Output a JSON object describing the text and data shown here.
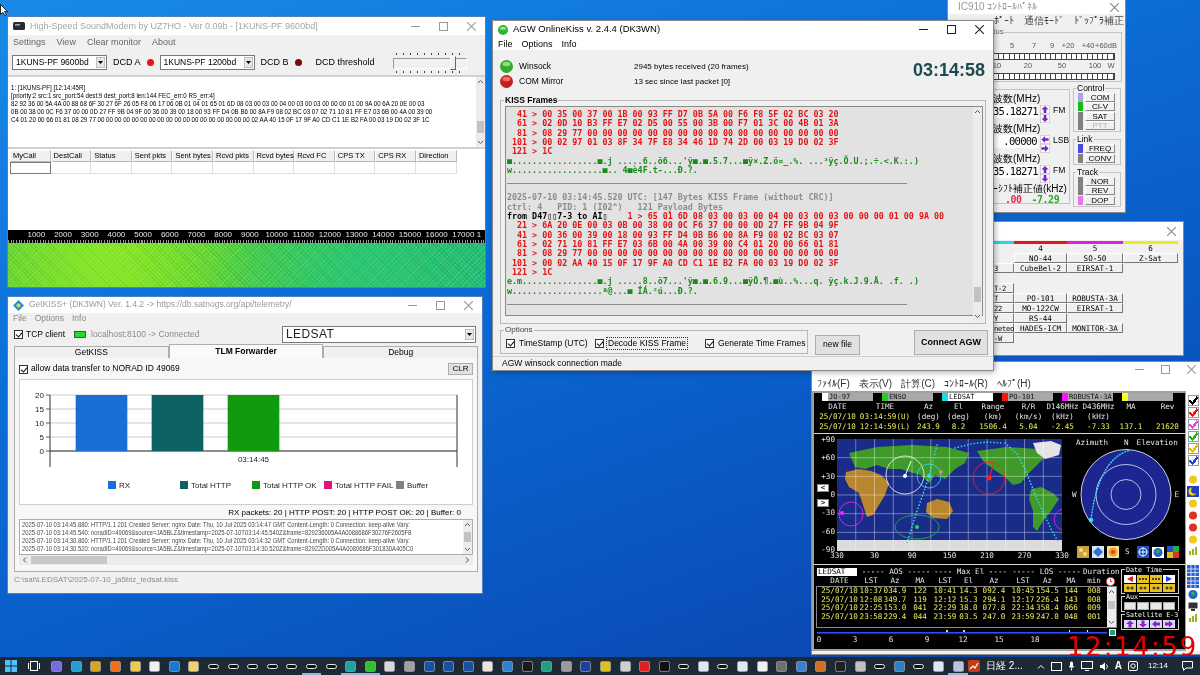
{
  "soundmodem": {
    "title": "High-Speed SoundModem by UZ7HO - Ver 0.09b - [1KUNS-PF 9600bd]",
    "menu": [
      "Settings",
      "View",
      "Clear monitor",
      "About"
    ],
    "modem_a": {
      "value": "1KUNS-PF 9600bd"
    },
    "dcd_a": {
      "label": "DCD A",
      "on": true
    },
    "modem_b": {
      "value": "1KUNS-PF 1200bd"
    },
    "dcd_b": {
      "label": "DCD B",
      "on": false
    },
    "threshold": {
      "label": "DCD threshold",
      "level": 0.82
    },
    "monitor": [
      "1: [1KUNS-PF] [12:14:45R]",
      "[priority:2 src:1 src_port:54 dest:9 dest_port:8 len:144 FEC_err:0 RS_err:4]",
      "82 92 36 00 5A 4A 00 88 68 6F 30 27 6F 26 05 F8 06 17 06 0B 01 04 01 65 01 6D 08 03 00 03 00 04 00 03 00 03 00 00 00 01 00 9A 00 6A 20 0E 00 03",
      "0B 00 38 00 0C F6 37 00 00 0D 27 FF 9B 04 9F 00 36 00 39 00 18 00 93 FF D4 0B B6 00 8A F9 08 02 BC 03 07 02 71 10 81 FF E7 03 6B 00 4A 00 39 00",
      "C4 01 20 00 66 01 81 08 29 77 00 00 00 00 00 00 00 00 00 00 00 00 00 00 00 00 00 00 02 AA 40 15 0F 17 9F A0 CD C1 1E B2 FA 00 03 19 D0 02 3F 1C"
    ],
    "table": {
      "columns": [
        "MyCall",
        "DestCall",
        "Status",
        "Sent pkts",
        "Sent bytes",
        "Rcvd pkts",
        "Rcvd bytes",
        "Rcvd FC",
        "CPS TX",
        "CPS RX",
        "Direction"
      ]
    },
    "waterfall": {
      "scale": [
        "1000",
        "2000",
        "3000",
        "4000",
        "5000",
        "6000",
        "7000",
        "8000",
        "9000",
        "10000",
        "11000",
        "12000",
        "13000",
        "14000",
        "15000",
        "16000",
        "17000",
        "1"
      ]
    }
  },
  "agw": {
    "title": "AGW OnlineKiss v. 2.4.4  (DK3WN)",
    "menu": [
      "File",
      "Options",
      "Info"
    ],
    "lamps": [
      {
        "label": "Winsock",
        "on": true
      },
      {
        "label": "COM Mirror",
        "on": false
      }
    ],
    "stats": [
      "2945 bytes received (20 frames)",
      "13 sec since last packet [0]"
    ],
    "clock": "03:14:58",
    "kiss_frames": {
      "label": "KISS Frames",
      "lines": [
        {
          "kind": "hex",
          "text": "  41 > 00 35 00 37 00 1B 00 93 FF D7 0B 5A 00 F6 F8 5F 02 BC 03 20"
        },
        {
          "kind": "hex",
          "text": "  61 > 02 0D 10 B3 FF E7 02 D5 00 55 00 3B 00 F7 01 3C 00 4B 01 3A"
        },
        {
          "kind": "hex",
          "text": "  81 > 08 29 77 00 00 00 00 00 00 00 00 00 00 00 00 00 00 00 00 00"
        },
        {
          "kind": "hex",
          "text": " 101 > 00 02 97 01 03 8F 34 7F E8 34 46 1D 74 2D 00 03 19 D0 02 3F"
        },
        {
          "kind": "hex",
          "text": " 121 > 1C"
        },
        {
          "kind": "ascii",
          "text": "■.................■.j .....6..ö6...'ÿ■.■.5.7...■ÿ×.Z.ö¤_.%. ...³ÿç.Õ.U.;.÷.<.K.:.)"
        },
        {
          "kind": "ascii",
          "text": "w..................■.. 4■è4F.t-...Ð.?."
        },
        {
          "kind": "rule"
        },
        {
          "kind": "meta",
          "text": "2025-07-10 03:14:45.520 UTC: [147 Bytes KISS Frame (without CRC)]"
        },
        {
          "kind": "meta",
          "text": "ctrl: 4   PID: 1 (I02^)   121 Payload Bytes"
        },
        {
          "kind": "from",
          "prefix": "from D47▯▯7-3 to AI▯",
          "text": "    1 > 65 01 6D 08 03 00 03 00 04 00 03 00 03 00 00 00 01 00 9A 00"
        },
        {
          "kind": "hex",
          "text": "  21 > 6A 20 0E 00 03 0B 00 38 00 0C F6 37 00 00 0D 27 FF 9B 04 9F"
        },
        {
          "kind": "hex",
          "text": "  41 > 00 36 00 39 00 18 00 93 FF D4 0B B6 00 8A F9 08 02 BC 03 07"
        },
        {
          "kind": "hex",
          "text": "  61 > 02 71 10 81 FF E7 03 6B 00 4A 00 39 00 C4 01 20 00 66 01 81"
        },
        {
          "kind": "hex",
          "text": "  81 > 08 29 77 00 00 00 00 00 00 00 00 00 00 00 00 00 00 00 00 00"
        },
        {
          "kind": "hex",
          "text": " 101 > 00 02 AA 40 15 0F 17 9F A0 CD C1 1E B2 FA 00 03 19 D0 02 3F"
        },
        {
          "kind": "hex",
          "text": " 121 > 1C"
        },
        {
          "kind": "ascii",
          "text": "e.m...............■.j .....8..ö7...'ÿ■.■.6.9...■ÿÖ.¶.■ù..%...q. ÿç.k.J.9.Ä. .f. .)"
        },
        {
          "kind": "ascii",
          "text": "w..................ª@...■ ÍÁ.²ú...Ð.?."
        },
        {
          "kind": "rule"
        }
      ]
    },
    "options": {
      "label": "Options",
      "checks": [
        {
          "label": "TimeStamp (UTC)",
          "checked": true,
          "focused": false
        },
        {
          "label": "Decode KISS Frame",
          "checked": true,
          "focused": true
        },
        {
          "label": "Generate Time Frames",
          "checked": true,
          "focused": false
        }
      ]
    },
    "buttons": [
      "new file",
      "Connect AGW"
    ],
    "status": "AGW winsock connection made"
  },
  "getkiss": {
    "title": "GetKISS+ (DK3WN) Ver. 1.4.2 -> https://db.satnogs.org/api/telemetry/",
    "menu": [
      "File",
      "Options",
      "Info"
    ],
    "tcp_client": {
      "label": "TCP client",
      "checked": true
    },
    "connection": {
      "text": "localhost:8100 -> Connected",
      "on": true
    },
    "satellite": {
      "value": "LEDSAT"
    },
    "tabs": [
      {
        "label": "GetKISS",
        "selected": false
      },
      {
        "label": "TLM Forwarder",
        "selected": true
      },
      {
        "label": "Debug",
        "selected": false
      }
    ],
    "allow": {
      "label": "allow data transfer to NORAD ID 49069",
      "checked": true
    },
    "clear_button": "CLR",
    "chart_data": {
      "type": "bar",
      "categories": [
        "03:14:45"
      ],
      "series": [
        {
          "name": "RX",
          "color": "#1a6fd4",
          "values": [
            20
          ]
        },
        {
          "name": "Total HTTP",
          "color": "#0d6263",
          "values": [
            20
          ]
        },
        {
          "name": "Total HTTP OK",
          "color": "#109a10",
          "values": [
            20
          ]
        },
        {
          "name": "Total HTTP FAIL",
          "color": "#e0157c",
          "values": [
            0
          ]
        },
        {
          "name": "Buffer",
          "color": "#808080",
          "values": [
            0
          ]
        }
      ],
      "ylim": [
        0,
        20
      ],
      "yticks": [
        {
          "value": 0,
          "label": "0"
        },
        {
          "value": 5,
          "label": "5"
        },
        {
          "value": 10,
          "label": "10"
        },
        {
          "value": 15,
          "label": "15"
        },
        {
          "value": 20,
          "label": "20"
        }
      ],
      "grid": true,
      "legend": true
    },
    "summary": "RX packets: 20 | HTTP POST: 20 | HTTP POST OK: 20 | Buffer: 0",
    "log": [
      "2025-07-10 03:14:45.880: HTTP/1.1 201 Created Server: nginx Date: Thu, 10 Jul 2025 03:14:47 GMT Content-Length: 0 Connection: keep-alive Vary:",
      "2025-07-10 03:14:45.540: noradID=49069&source=JA5BLZ&timestamp=2025-07-10T03:14:45.540Z&frame=829236005A4A0088686F30276F2605F8",
      "2025-07-10 03:14:30.860: HTTP/1.1 201 Created Server: nginx Date: Thu, 10 Jul 2025 03:14:32 GMT Content-Length: 0 Connection: keep-alive Vary:",
      "2025-07-10 03:14:30.520: noradID=49069&source=JA5BLZ&timestamp=2025-07-10T03:14:30.520Z&frame=82922D005A4A0080686F301830A405C0"
    ],
    "file_path": "C:\\sat\\LEDSAT\\2025-07-10_ja5blz_ledsat.kiss"
  },
  "ic910": {
    "title": "IC910 ｺﾝﾄﾛｰﾙﾊﾟﾈﾙ",
    "menu": [
      "ﾎﾟｰﾄ",
      "通信ﾓｰﾄﾞ",
      "ﾄﾞｯﾌﾟﾗ補正"
    ],
    "status": {
      "label": "tus",
      "s_scale": [
        "5",
        "7",
        "9",
        "+20",
        "+40",
        "+60dB"
      ],
      "po_scale": [
        "10",
        "20",
        "50",
        "100",
        "W"
      ]
    },
    "frequencies": [
      {
        "label": "波数(MHz)",
        "value": "35.18271",
        "kind": "vertical_arrows",
        "mode": "FM"
      },
      {
        "label": "波数(MHz)",
        "value": ".00000",
        "kind": "horizontal_arrows",
        "mode": "LSB"
      },
      {
        "label": "波数(MHz)",
        "value": "35.18271",
        "kind": "vertical_arrows",
        "mode": "FM"
      }
    ],
    "doppler": {
      "label": "ｰｼﾌﾄ補正値(kHz)",
      "values": [
        {
          "text": ".00",
          "color": "#e0305a"
        },
        {
          "text": "-7.29",
          "color": "#2aa82a"
        }
      ]
    },
    "control": {
      "label": "Control",
      "items": [
        {
          "label": "COM",
          "color": "#a8a8e8",
          "disabled": false
        },
        {
          "label": "CI-V",
          "color": "#10c010",
          "disabled": false
        },
        {
          "label": "SAT",
          "color": "#808080",
          "disabled": false
        },
        {
          "label": "PTT",
          "color": "#808080",
          "disabled": true
        }
      ]
    },
    "link": {
      "label": "Link",
      "items": [
        {
          "label": "FREQ",
          "color": "#4a4ae0"
        },
        {
          "label": "CONV",
          "color": "#808080"
        }
      ]
    },
    "track": {
      "label": "Track",
      "items": [
        {
          "label": "NOR",
          "color": "#808080"
        },
        {
          "label": "REV",
          "color": "#808080"
        },
        {
          "label": "DOP",
          "color": "#e878e8"
        }
      ]
    }
  },
  "sat_list": {
    "columns": [
      {
        "color": "#20d8e8"
      },
      {
        "label": "4",
        "color": "#e01818"
      },
      {
        "label": "5",
        "color": "#e020e0"
      },
      {
        "label": "6",
        "color": "#f0e820"
      }
    ],
    "groups": [
      {
        "rows": [
          [
            null,
            "NO-44",
            "SO-50",
            "Z-Sat"
          ],
          [
            "3",
            "CubeBel-2",
            "EIRSAT-1"
          ]
        ]
      },
      {
        "rows": [
          [
            "T-2"
          ],
          [
            "T",
            "PO-101",
            "ROBUSTA-3A"
          ],
          [
            "22",
            "MO-122CW",
            "EIRSAT-1"
          ],
          [
            "Y",
            "RS-44"
          ],
          [
            "neteo",
            "HADES-ICM",
            "MONITOR-3A"
          ],
          [
            "-W"
          ]
        ]
      }
    ]
  },
  "tracker": {
    "menu": [
      "ﾌｧｲﾙ(F)",
      "表示(V)",
      "計算(C)",
      "ｺﾝﾄﾛｰﾙ(R)",
      "ﾍﾙﾌﾟ(H)"
    ],
    "satellites": [
      {
        "label": "JO-97",
        "color": "#ffffff",
        "selected": false
      },
      {
        "label": "ENSO",
        "color": "#20d020",
        "selected": false
      },
      {
        "label": "LEDSAT",
        "color": "#10e0e8",
        "selected": true
      },
      {
        "label": "PO-101",
        "color": "#ff1010",
        "selected": false
      },
      {
        "label": "ROBUSTA-3A",
        "color": "#ff10ff",
        "selected": false
      },
      {
        "color": "#ffff10",
        "selected": false
      }
    ],
    "position": {
      "columns": [
        {
          "label": "DATE"
        },
        {
          "label": "TIME"
        },
        {
          "label": "Az",
          "unit": "(deg)"
        },
        {
          "label": "El",
          "unit": "(deg)"
        },
        {
          "label": "Range",
          "unit": "(km)"
        },
        {
          "label": "R/R",
          "unit": "(km/s)"
        },
        {
          "label": "D146MHz",
          "unit": "(kHz)"
        },
        {
          "label": "D436MHz",
          "unit": "(kHz)"
        },
        {
          "label": "MA"
        },
        {
          "label": "Rev"
        }
      ],
      "rows": [
        [
          "25/07/10",
          "03:14:59(U)"
        ],
        [
          "25/07/10",
          "12:14:59(L)",
          "243.9",
          "8.2",
          "1506.4",
          "5.04",
          "-2.45",
          "-7.33",
          "137.1",
          "21620"
        ]
      ]
    },
    "map": {
      "lat_labels": [
        "+90",
        "+60",
        "+30",
        "0",
        "-30",
        "-60",
        "-90"
      ],
      "lon_labels": [
        "330",
        "30",
        "90",
        "150",
        "210",
        "270",
        "330"
      ],
      "nav": [
        "<",
        ">"
      ]
    },
    "polar": {
      "azimuth": "Azimuth",
      "north": "N",
      "elevation": "Elevation",
      "west": "W",
      "east": "E",
      "south": "S"
    },
    "passes": {
      "satellite": "LEDSAT",
      "groups": [
        "----- AOS -----",
        "---- Max El ----",
        "----- LOS -----",
        "Duration"
      ],
      "columns": [
        "DATE",
        "LST",
        "Az",
        "MA",
        "LST",
        "El",
        "Az",
        "LST",
        "Az",
        "MA",
        "min"
      ],
      "rows": [
        [
          "25/07/10",
          "10:37",
          "034.9",
          "122",
          "10:41",
          "14.3",
          "092.4",
          "10:45",
          "154.5",
          "144",
          "008"
        ],
        [
          "25/07/10",
          "12:08",
          "349.7",
          "119",
          "12:12",
          "15.3",
          "294.1",
          "12:17",
          "226.4",
          "143",
          "008"
        ],
        [
          "25/07/10",
          "22:25",
          "153.0",
          "041",
          "22:29",
          "38.0",
          "077.8",
          "22:34",
          "358.4",
          "066",
          "009"
        ],
        [
          "25/07/10",
          "23:58",
          "229.4",
          "044",
          "23:59",
          "03.5",
          "247.0",
          "23:59",
          "247.0",
          "048",
          "001"
        ]
      ]
    },
    "timeline": [
      "0",
      "3",
      "6",
      "9",
      "12",
      "15",
      "18"
    ],
    "panels": [
      {
        "label": "Date Time"
      },
      {
        "label": "Aux"
      },
      {
        "label": "Satellite E-3"
      }
    ],
    "side_checks": [
      {
        "checked": true,
        "color": "#000000"
      },
      {
        "checked": true,
        "color": "#e01818"
      },
      {
        "checked": true,
        "color": "#e050e0"
      },
      {
        "checked": true,
        "color": "#20b020"
      },
      {
        "checked": true,
        "color": "#e0c000"
      },
      {
        "checked": true,
        "color": "#2040e0"
      }
    ]
  },
  "overlay_clock": {
    "time": "12:14:59"
  },
  "taskbar": {
    "apps": [
      {
        "kind": "tile",
        "color": "#7a6ae0",
        "running": false
      },
      {
        "kind": "tile",
        "color": "#1fa0d0",
        "running": false
      },
      {
        "kind": "tile",
        "color": "#d9a620",
        "running": false
      },
      {
        "kind": "tile",
        "color": "#f07020",
        "running": false
      },
      {
        "kind": "tile",
        "color": "#f2c94c",
        "running": false
      },
      {
        "kind": "tile",
        "color": "#f0f0f0",
        "running": false
      },
      {
        "kind": "tile",
        "color": "#1a78d0",
        "running": false
      },
      {
        "kind": "tile",
        "color": "#f0d070",
        "running": false
      },
      {
        "kind": "pill",
        "running": false
      },
      {
        "kind": "pill",
        "running": false
      },
      {
        "kind": "pill",
        "running": false
      },
      {
        "kind": "pill",
        "running": false
      },
      {
        "kind": "pill",
        "running": false
      },
      {
        "kind": "pill",
        "running": true
      },
      {
        "kind": "pill",
        "running": false
      },
      {
        "kind": "tile",
        "color": "#20a0a0",
        "running": true
      },
      {
        "kind": "tile",
        "color": "#30c030",
        "running": true
      },
      {
        "kind": "tile",
        "color": "#d8d8d8",
        "running": false
      },
      {
        "kind": "tile",
        "color": "#a0a0a0",
        "running": false
      },
      {
        "kind": "tile",
        "color": "#1a50a0",
        "running": false
      },
      {
        "kind": "tile",
        "color": "#1a50a0",
        "running": false
      },
      {
        "kind": "tile",
        "color": "#1a50a0",
        "running": false
      },
      {
        "kind": "tile",
        "color": "#f0e0e0",
        "running": false
      },
      {
        "kind": "tile",
        "color": "#3080d0",
        "running": false
      },
      {
        "kind": "tile",
        "color": "#1a1a1a",
        "running": false
      },
      {
        "kind": "tile",
        "color": "#20a080",
        "running": false
      },
      {
        "kind": "tile",
        "color": "#9a9a9a",
        "running": false
      },
      {
        "kind": "tile",
        "color": "#2040a0",
        "running": false
      },
      {
        "kind": "tile",
        "color": "#e0c020",
        "running": false
      },
      {
        "kind": "tile",
        "color": "#cfcfcf",
        "running": false
      },
      {
        "kind": "tile",
        "color": "#e02020",
        "running": false
      },
      {
        "kind": "tile",
        "color": "#111111",
        "running": false
      },
      {
        "kind": "pill",
        "running": false
      },
      {
        "kind": "tile",
        "color": "#dfe8f0",
        "running": false
      },
      {
        "kind": "pill",
        "running": false
      },
      {
        "kind": "tile",
        "color": "#dfe8f0",
        "running": false
      },
      {
        "kind": "tile",
        "color": "#f0f0f0",
        "running": false
      },
      {
        "kind": "tile",
        "color": "#707070",
        "running": false
      },
      {
        "kind": "tile",
        "color": "#3a80d0",
        "running": false
      },
      {
        "kind": "tile",
        "color": "#d07020",
        "running": false
      },
      {
        "kind": "tile",
        "color": "#202020",
        "running": false
      },
      {
        "kind": "tile",
        "color": "#c0c0c0",
        "running": false
      },
      {
        "kind": "pill",
        "running": false
      },
      {
        "kind": "tile",
        "color": "#3080c0",
        "running": false
      },
      {
        "kind": "pill",
        "running": false
      },
      {
        "kind": "tile",
        "color": "#dfe8f0",
        "running": false
      },
      {
        "kind": "tile",
        "color": "#c0c0e0",
        "running": true
      }
    ],
    "news": "日経 2...",
    "ime": "A",
    "clock": "12:14"
  }
}
